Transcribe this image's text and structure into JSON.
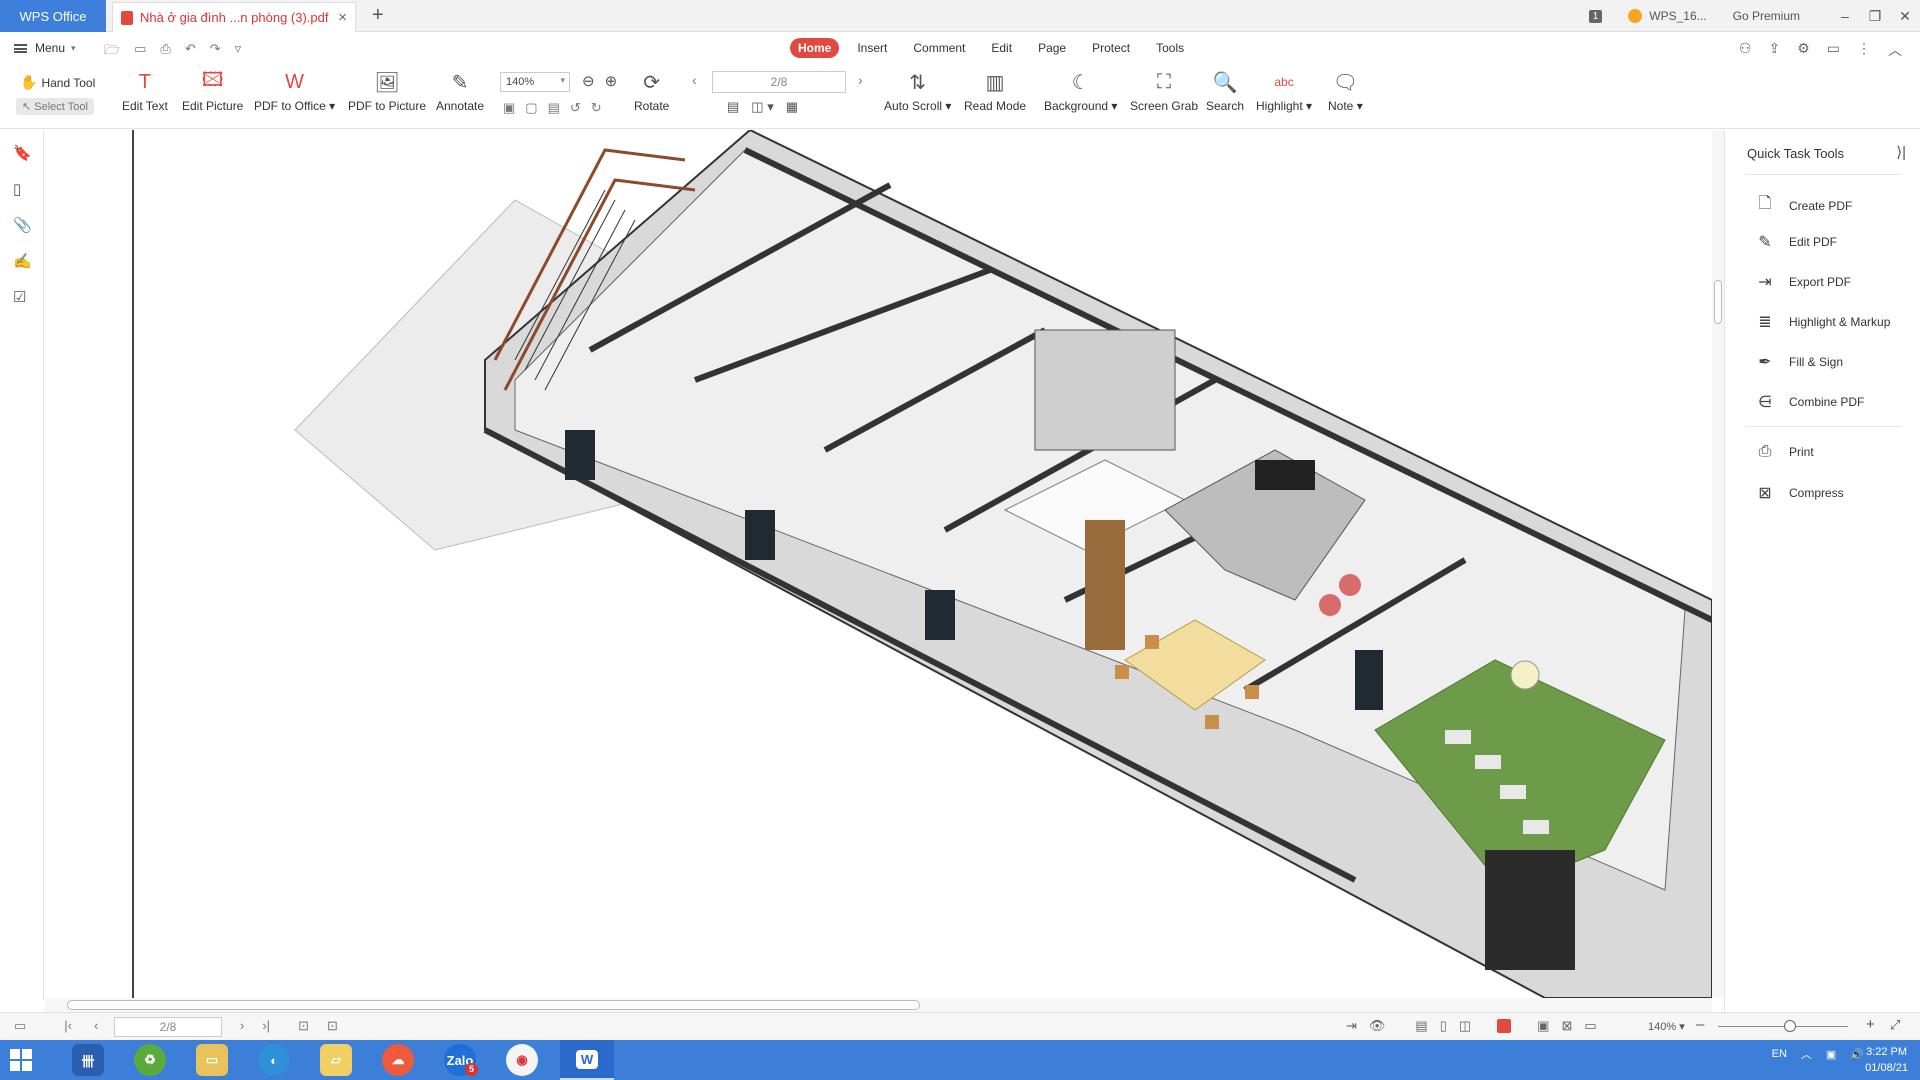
{
  "titlebar": {
    "app_tab": "WPS Office",
    "doc_tab": "Nhà ở gia đình ...n phòng (3).pdf",
    "new_tab": "+",
    "badge": "1",
    "account": "WPS_16...",
    "premium": "Go Premium"
  },
  "menubar": {
    "menu": "Menu",
    "tabs": [
      "Home",
      "Insert",
      "Comment",
      "Edit",
      "Page",
      "Protect",
      "Tools"
    ],
    "active_tab": "Home"
  },
  "toolbar": {
    "hand_tool": "Hand Tool",
    "select_tool": "Select Tool",
    "edit_text": "Edit Text",
    "edit_picture": "Edit Picture",
    "pdf_to_office": "PDF to Office",
    "pdf_to_picture": "PDF to Picture",
    "annotate": "Annotate",
    "zoom": "140%",
    "rotate": "Rotate",
    "page": "2/8",
    "auto_scroll": "Auto Scroll",
    "read_mode": "Read Mode",
    "background": "Background",
    "screen_grab": "Screen Grab",
    "search": "Search",
    "highlight": "Highlight",
    "note": "Note"
  },
  "panel": {
    "title": "Quick Task Tools",
    "tools": [
      "Create PDF",
      "Edit PDF",
      "Export PDF",
      "Highlight & Markup",
      "Fill & Sign",
      "Combine PDF"
    ],
    "tools2": [
      "Print",
      "Compress"
    ]
  },
  "statusbar": {
    "page": "2/8",
    "zoom": "140%"
  },
  "taskbar": {
    "lang": "EN",
    "time": "3:22 PM",
    "date": "01/08/21",
    "zalo_badge": "5"
  },
  "colors": {
    "accent": "#e04a3f",
    "wps_blue": "#3d7fdb",
    "taskbar": "#3c7fd8"
  }
}
